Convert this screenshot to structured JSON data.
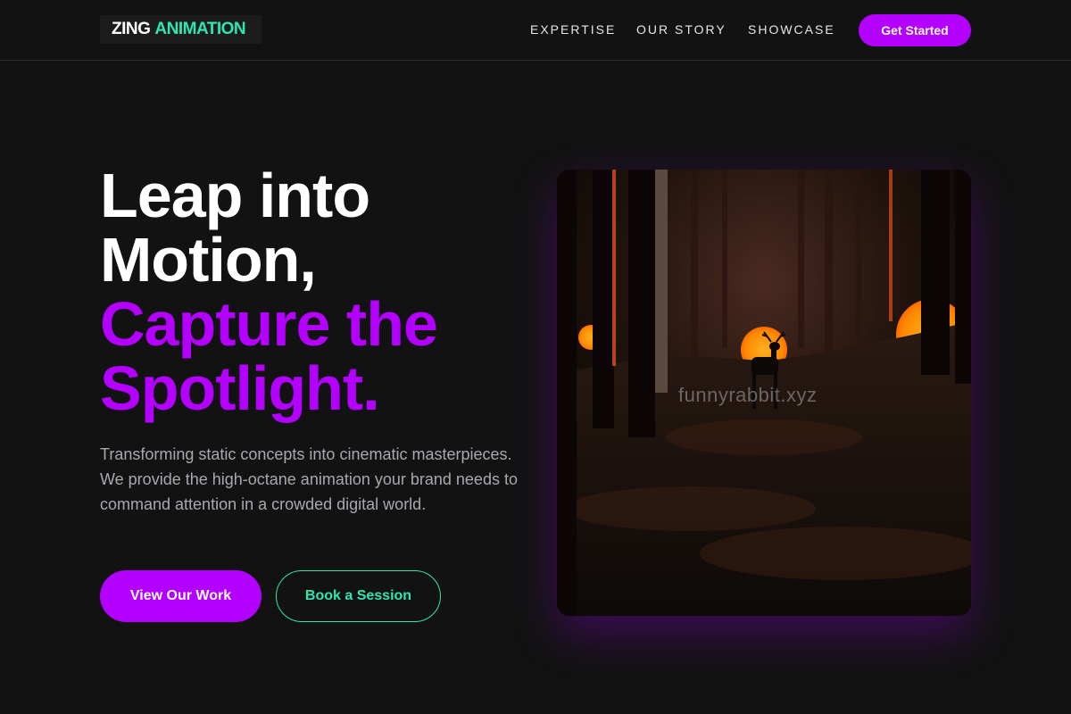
{
  "brand": {
    "word1": "ZING",
    "word2": "ANIMATION",
    "accent_color": "#2ee6b0",
    "brand_color": "#b300ff"
  },
  "nav": {
    "items": [
      {
        "label": "EXPERTISE"
      },
      {
        "label": "OUR STORY"
      },
      {
        "label": "SHOWCASE"
      }
    ],
    "cta_label": "Get Started"
  },
  "hero": {
    "headline_white_1": "Leap into",
    "headline_white_2": "Motion,",
    "headline_purple_1": "Capture the",
    "headline_purple_2": "Spotlight.",
    "description": "Transforming static concepts into cinematic masterpieces. We provide the high-octane animation your brand needs to command attention in a crowded digital world.",
    "primary_button": "View Our Work",
    "secondary_button": "Book a Session",
    "image_watermark": "funnyrabbit.xyz"
  }
}
